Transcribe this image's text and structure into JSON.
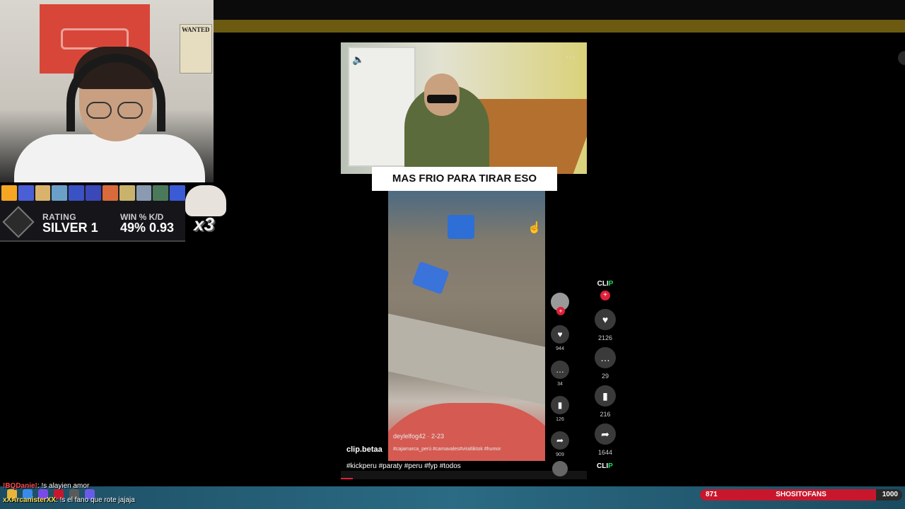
{
  "webcam": {
    "poster_text": "WANTED"
  },
  "rank": {
    "rating_label": "RATING",
    "rating_value": "SILVER 1",
    "win_label": "WIN % K/D",
    "win_value": "49% 0.93",
    "multiplier": "x3",
    "avatar_colors": [
      "#f5a623",
      "#4a5fd6",
      "#d9b36b",
      "#6aa0c8",
      "#3b52c4",
      "#3b48b8",
      "#d96a3b",
      "#c9b26b",
      "#8a9ab0",
      "#4a7a5a",
      "#3b5bd6"
    ]
  },
  "clip": {
    "caption": "MAS FRIO PARA TIRAR ESO",
    "video_user": "deylelfog42 · 2-23",
    "video_tags": "#cajamarca_perú #carnavales#viraltiktok #humor",
    "channel": "clip.betaa",
    "hashtags": "#kickperu #paraty #peru #fyp #todos",
    "progress": 0.05,
    "mute_icon": "speaker-icon",
    "more_icon": "more-icon"
  },
  "inner_actions": {
    "likes": "944",
    "comments": "34",
    "saves": "126",
    "shares": "909"
  },
  "outer_actions": {
    "logo_text": "CLI",
    "logo_accent": "P",
    "likes": "2126",
    "comments": "29",
    "saves": "216",
    "shares": "1644"
  },
  "chat": [
    {
      "user": "!BQDanie!",
      "message": ": !s alayien amor"
    },
    {
      "user": "xXArcanisterXX",
      "message": ": !s el fano que rote jajaja"
    }
  ],
  "goal": {
    "current": "871",
    "name": "SHOSITOFANS",
    "max": "1000",
    "fraction": 0.871,
    "color": "#c8172d"
  }
}
